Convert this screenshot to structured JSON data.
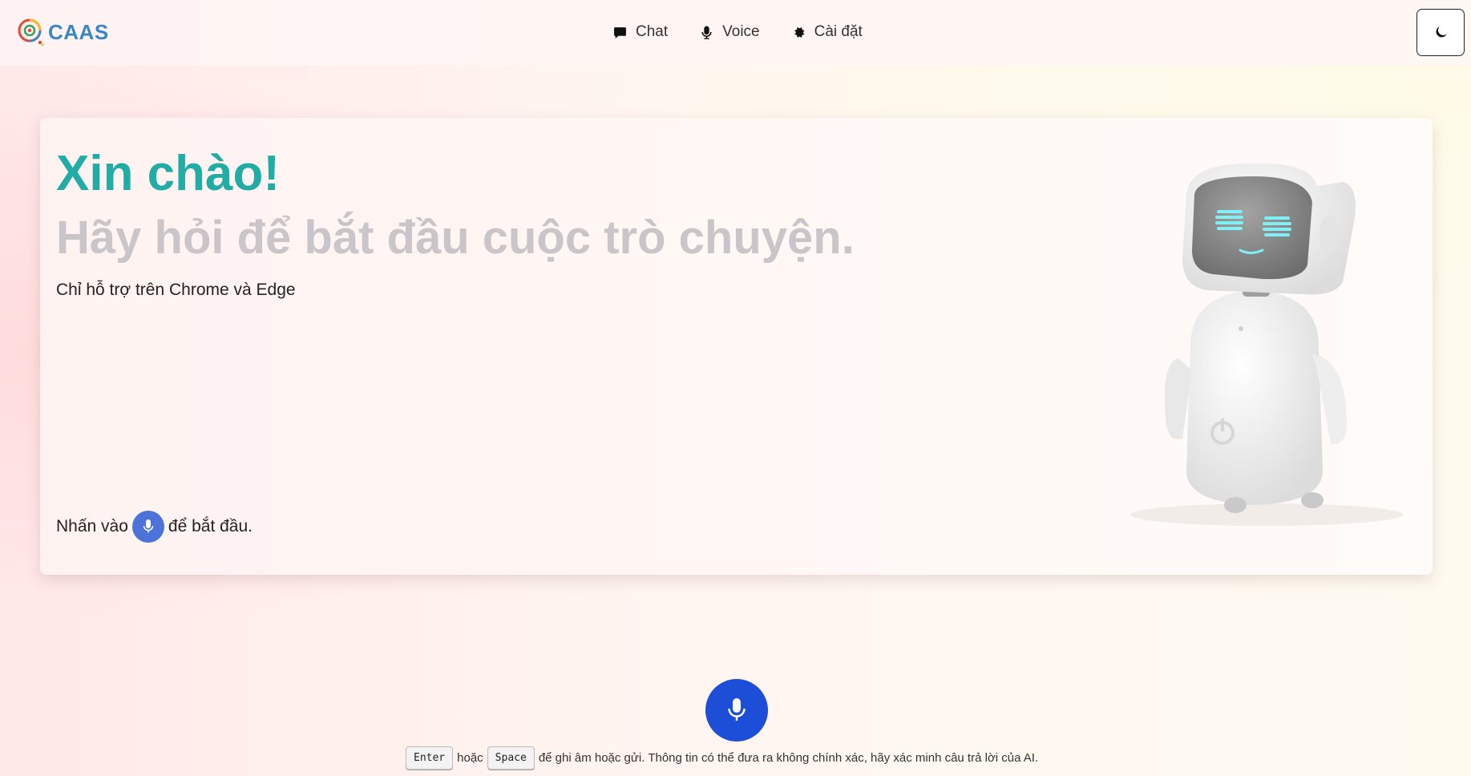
{
  "brand": {
    "name": "CAAS"
  },
  "nav": {
    "items": [
      {
        "label": "Chat",
        "icon": "chat-bubble-icon"
      },
      {
        "label": "Voice",
        "icon": "microphone-icon"
      },
      {
        "label": "Cài đặt",
        "icon": "gear-icon"
      }
    ]
  },
  "theme_toggle": {
    "icon": "moon-icon"
  },
  "hero": {
    "greeting": "Xin chào!",
    "subtitle": "Hãy hỏi để bắt đầu cuộc trò chuyện.",
    "support_note": "Chỉ hỗ trợ trên Chrome và Edge",
    "hint_before": "Nhấn vào",
    "hint_after": "để bắt đầu."
  },
  "footer": {
    "key1": "Enter",
    "or": "hoặc",
    "key2": "Space",
    "text": "để ghi âm hoặc gửi. Thông tin có thể đưa ra không chính xác, hãy xác minh câu trả lời của AI."
  },
  "colors": {
    "accent": "#22aca6",
    "primary_button": "#1d4ed8",
    "inline_mic": "#4b73d9",
    "muted_heading": "#c9c5c8"
  }
}
